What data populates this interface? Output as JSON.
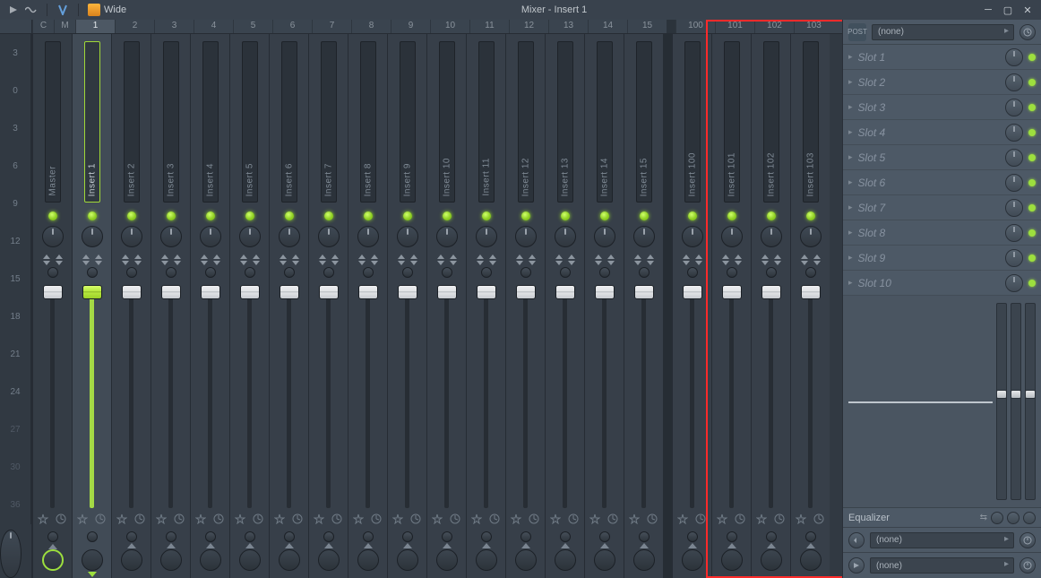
{
  "titlebar": {
    "layout_label": "Wide",
    "title": "Mixer - Insert 1"
  },
  "header_cells": {
    "c": "C",
    "m": "M",
    "gap": "",
    "nums_a": [
      "1",
      "2",
      "3",
      "4",
      "5",
      "6",
      "7",
      "8",
      "9",
      "10",
      "11",
      "12",
      "13",
      "14",
      "15"
    ],
    "nums_b": [
      "100",
      "101",
      "102",
      "103"
    ]
  },
  "db_ticks": [
    "3",
    "0",
    "3",
    "6",
    "9",
    "12",
    "15",
    "18",
    "21",
    "24",
    "27",
    "30",
    "36"
  ],
  "tracks_a": [
    {
      "label": "Master",
      "master": true
    },
    {
      "label": "Insert 1",
      "selected": true
    },
    {
      "label": "Insert 2"
    },
    {
      "label": "Insert 3"
    },
    {
      "label": "Insert 4"
    },
    {
      "label": "Insert 5"
    },
    {
      "label": "Insert 6"
    },
    {
      "label": "Insert 7"
    },
    {
      "label": "Insert 8"
    },
    {
      "label": "Insert 9"
    },
    {
      "label": "Insert 10"
    },
    {
      "label": "Insert 11"
    },
    {
      "label": "Insert 12"
    },
    {
      "label": "Insert 13"
    },
    {
      "label": "Insert 14"
    },
    {
      "label": "Insert 15"
    }
  ],
  "tracks_b": [
    {
      "label": "Insert 100"
    },
    {
      "label": "Insert 101"
    },
    {
      "label": "Insert 102"
    },
    {
      "label": "Insert 103"
    }
  ],
  "right": {
    "input": {
      "post_label": "POST",
      "value": "(none)"
    },
    "slots": [
      {
        "name": "Slot 1"
      },
      {
        "name": "Slot 2"
      },
      {
        "name": "Slot 3"
      },
      {
        "name": "Slot 4"
      },
      {
        "name": "Slot 5"
      },
      {
        "name": "Slot 6"
      },
      {
        "name": "Slot 7"
      },
      {
        "name": "Slot 8"
      },
      {
        "name": "Slot 9"
      },
      {
        "name": "Slot 10"
      }
    ],
    "eq_label": "Equalizer",
    "out1": "(none)",
    "out2": "(none)"
  }
}
